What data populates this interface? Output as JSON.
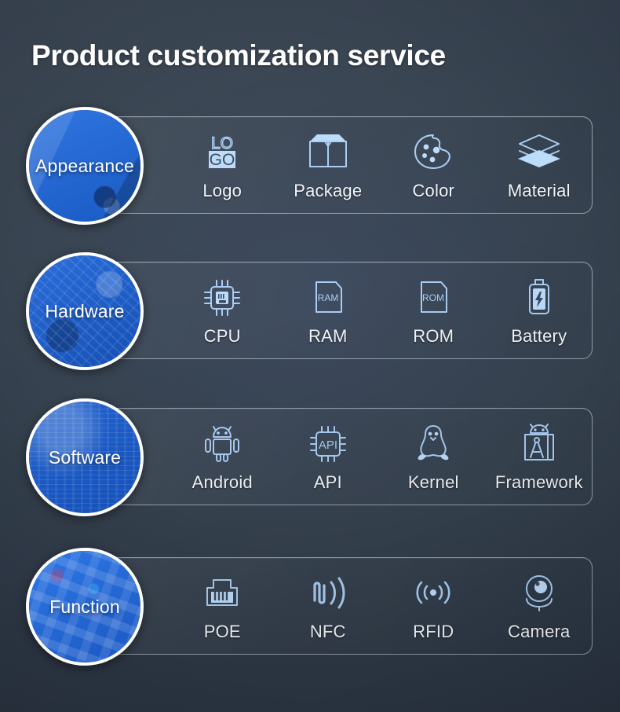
{
  "page": {
    "title": "Product customization service",
    "background_color": "#36424f",
    "accent_color": "#1f68de",
    "icon_color": "#a9cdf4",
    "text_color": "#f2f5f9"
  },
  "rows": [
    {
      "category": "Appearance",
      "category_icon": "appearance-photo",
      "items": [
        {
          "label": "Logo",
          "icon": "logo-icon"
        },
        {
          "label": "Package",
          "icon": "package-box-icon"
        },
        {
          "label": "Color",
          "icon": "color-palette-icon"
        },
        {
          "label": "Material",
          "icon": "material-layers-icon"
        }
      ]
    },
    {
      "category": "Hardware",
      "category_icon": "circuit-board-photo",
      "items": [
        {
          "label": "CPU",
          "icon": "cpu-chip-icon"
        },
        {
          "label": "RAM",
          "icon": "ram-card-icon"
        },
        {
          "label": "ROM",
          "icon": "rom-card-icon"
        },
        {
          "label": "Battery",
          "icon": "battery-bolt-icon"
        }
      ]
    },
    {
      "category": "Software",
      "category_icon": "code-screen-photo",
      "items": [
        {
          "label": "Android",
          "icon": "android-robot-icon"
        },
        {
          "label": "API",
          "icon": "api-chip-icon"
        },
        {
          "label": "Kernel",
          "icon": "linux-penguin-icon"
        },
        {
          "label": "Framework",
          "icon": "framework-compass-icon"
        }
      ]
    },
    {
      "category": "Function",
      "category_icon": "app-icons-photo",
      "items": [
        {
          "label": "POE",
          "icon": "ethernet-port-icon"
        },
        {
          "label": "NFC",
          "icon": "nfc-wave-icon"
        },
        {
          "label": "RFID",
          "icon": "rfid-signal-icon"
        },
        {
          "label": "Camera",
          "icon": "camera-dome-icon"
        }
      ]
    }
  ],
  "logo_icon_text": {
    "top": "LO",
    "bottom": "GO"
  },
  "ram_icon_text": "RAM",
  "rom_icon_text": "ROM",
  "api_icon_text": "API"
}
